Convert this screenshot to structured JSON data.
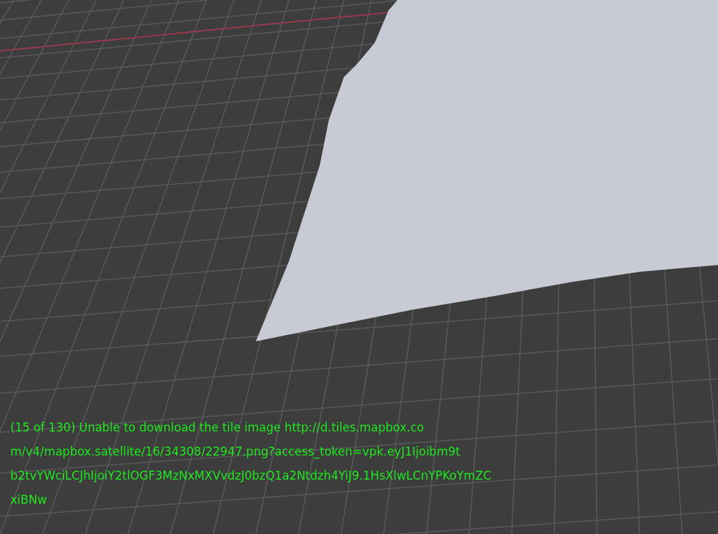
{
  "viewport": {
    "message_lines": [
      "(15 of 130) Unable to download the tile image http://d.tiles.mapbox.co",
      "m/v4/mapbox.satellite/16/34308/22947.png?access_token=vpk.eyJ1Ijoibm9t",
      "b2tvYWciLCJhIjoiY2tlOGF3MzNxMXVvdzJ0bzQ1a2Ntdzh4YiJ9.1HsXlwLCnYPKoYmZC",
      "xiBNw"
    ]
  }
}
